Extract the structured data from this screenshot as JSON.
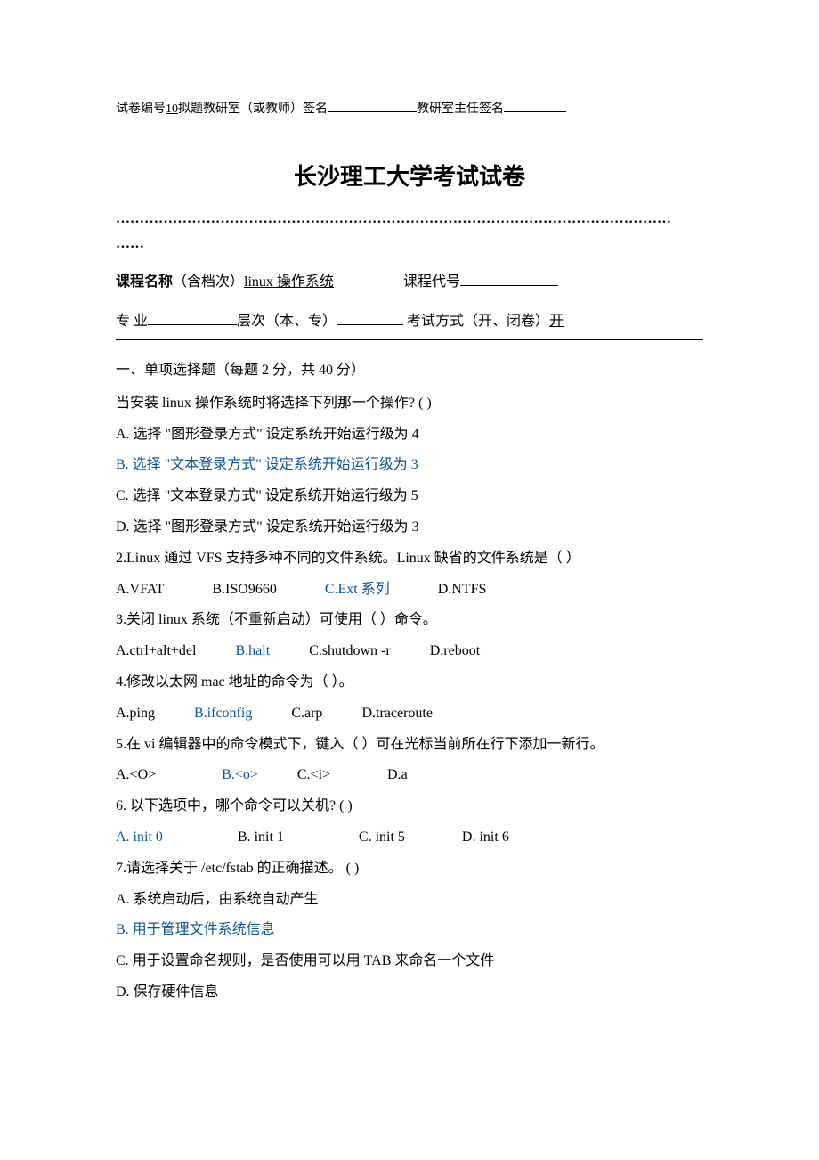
{
  "header": {
    "paper_no_label": "试卷编号",
    "paper_no_value": "  10     ",
    "proposer_label": "拟题教研室（或教师）签名",
    "director_label": "教研室主任签名"
  },
  "title": "长沙理工大学考试试卷",
  "dots": "………………………………………………………………………………………………………",
  "dots2": "……",
  "course": {
    "name_label": "课程名称",
    "name_paren": "（含档次）",
    "name_value": "        linux 操作系统          ",
    "code_label": "课程代号"
  },
  "meta": {
    "major_label": "专    业",
    "level_label": "层次（本、专）",
    "exam_type_label": "考试方式（开、闭卷）",
    "exam_type_value": "     开     "
  },
  "section1": "一、单项选择题（每题 2 分，共 40 分）",
  "q1": {
    "stem": "当安装 linux 操作系统时将选择下列那一个操作? (    )",
    "a": "A.  选择  \"图形登录方式\"  设定系统开始运行级为 4",
    "b": "B.  选择  \"文本登录方式\"  设定系统开始运行级为 3",
    "c": "C.  选择  \"文本登录方式\"  设定系统开始运行级为 5",
    "d": "D.  选择  \"图形登录方式\"  设定系统开始运行级为 3"
  },
  "q2": {
    "stem": "2.Linux 通过 VFS 支持多种不同的文件系统。Linux 缺省的文件系统是（    ）",
    "a": "A.VFAT",
    "b": "B.ISO9660",
    "c": "C.Ext 系列",
    "d": "D.NTFS"
  },
  "q3": {
    "stem": "3.关闭 linux 系统（不重新启动）可使用（    ）命令。",
    "a": "A.ctrl+alt+del",
    "b": "B.halt",
    "c": "C.shutdown  -r",
    "d": "D.reboot"
  },
  "q4": {
    "stem": "4.修改以太网 mac 地址的命令为（    ）。",
    "a": "A.ping",
    "b": "B.ifconfig",
    "c": "C.arp",
    "d": "D.traceroute"
  },
  "q5": {
    "stem": "5.在 vi 编辑器中的命令模式下，键入（    ）可在光标当前所在行下添加一新行。",
    "a": "A.<O>",
    "b": "B.<o>",
    "c": "C.<i>",
    "d": "D.a"
  },
  "q6": {
    "stem": "6.  以下选项中，哪个命令可以关机? (      )",
    "a": "A. init 0",
    "b": "B. init 1",
    "c": "C. init 5",
    "d": "D. init 6"
  },
  "q7": {
    "stem": "7.请选择关于  /etc/fstab  的正确描述。 (        )",
    "a": "A.  系统启动后，由系统自动产生",
    "b": "B.  用于管理文件系统信息",
    "c": "C.  用于设置命名规则，是否使用可以用  TAB  来命名一个文件",
    "d": "D.  保存硬件信息"
  }
}
